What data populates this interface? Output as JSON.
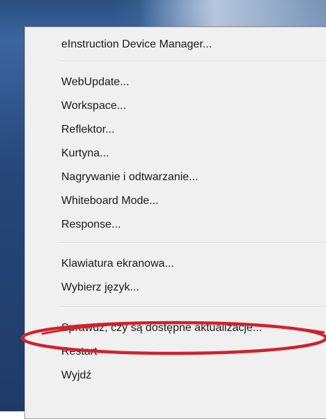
{
  "context_menu": {
    "items": [
      {
        "label": "eInstruction Device Manager..."
      },
      {
        "label": "WebUpdate..."
      },
      {
        "label": "Workspace..."
      },
      {
        "label": "Reflektor..."
      },
      {
        "label": "Kurtyna..."
      },
      {
        "label": "Nagrywanie i odtwarzanie..."
      },
      {
        "label": "Whiteboard Mode..."
      },
      {
        "label": "Response..."
      },
      {
        "label": "Klawiatura ekranowa..."
      },
      {
        "label": "Wybierz język..."
      },
      {
        "label": "Sprawdź, czy są dostępne aktualizacje..."
      },
      {
        "label": "Restart"
      },
      {
        "label": "Wyjdź"
      }
    ],
    "highlighted_item": "Sprawdź, czy są dostępne aktualizacje...",
    "annotation_color": "#d0222a"
  }
}
